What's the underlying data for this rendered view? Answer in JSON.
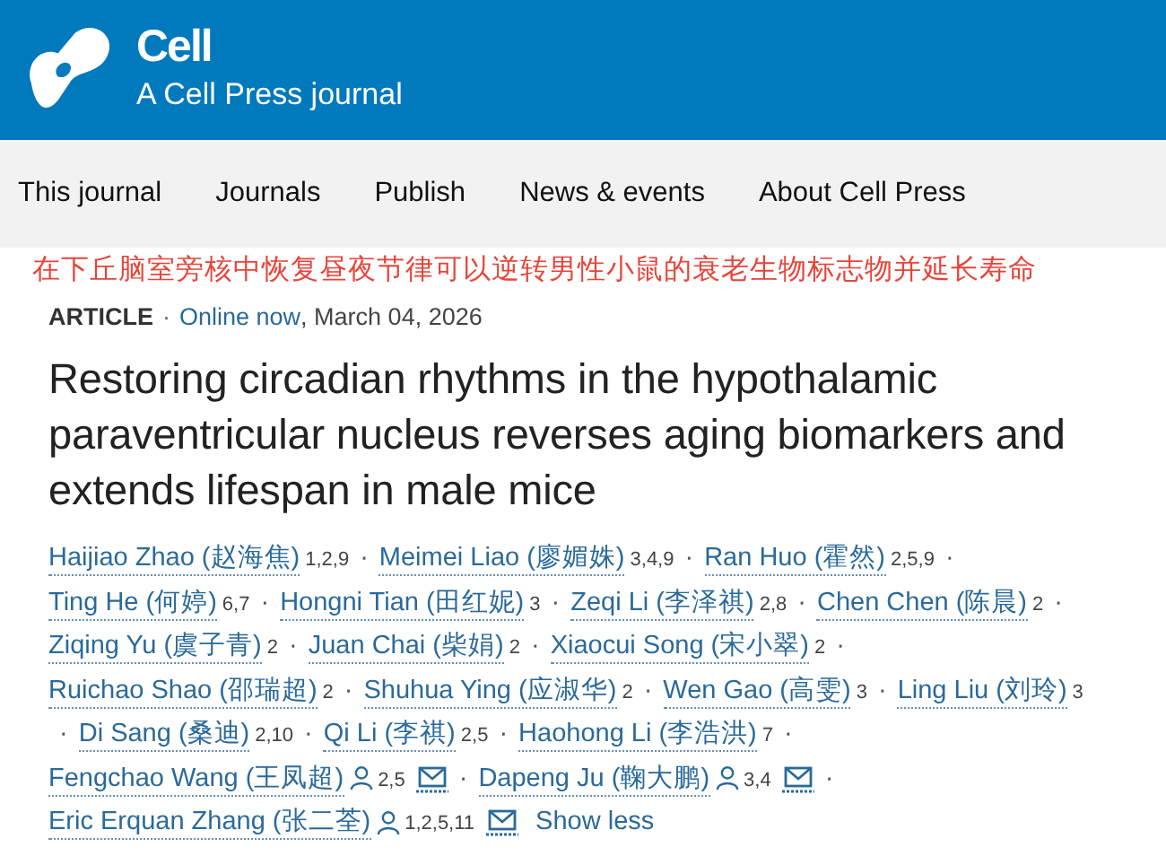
{
  "header": {
    "brand": "Cell",
    "tagline": "A Cell Press journal"
  },
  "nav": [
    {
      "label": "This journal"
    },
    {
      "label": "Journals"
    },
    {
      "label": "Publish"
    },
    {
      "label": "News & events"
    },
    {
      "label": "About Cell Press"
    }
  ],
  "translation": "在下丘脑室旁核中恢复昼夜节律可以逆转男性小鼠的衰老生物标志物并延长寿命",
  "meta": {
    "type": "ARTICLE",
    "dot": "·",
    "status": "Online now",
    "date": ", March 04, 2026"
  },
  "title": "Restoring circadian rhythms in the hypothalamic paraventricular nucleus reverses aging biomarkers and extends lifespan in male mice",
  "author_lines": [
    [
      {
        "kind": "author",
        "name": "Haijiao Zhao (赵海焦)",
        "affil": "1,2,9",
        "corresponding": false,
        "email": false
      },
      {
        "kind": "sep",
        "text": "·"
      },
      {
        "kind": "author",
        "name": "Meimei Liao (廖媚姝)",
        "affil": "3,4,9",
        "corresponding": false,
        "email": false
      },
      {
        "kind": "sep",
        "text": "·"
      },
      {
        "kind": "author",
        "name": "Ran Huo (霍然)",
        "affil": "2,5,9",
        "corresponding": false,
        "email": false
      },
      {
        "kind": "sep",
        "text": "·"
      }
    ],
    [
      {
        "kind": "author",
        "name": "Ting He (何婷)",
        "affil": "6,7",
        "corresponding": false,
        "email": false
      },
      {
        "kind": "sep",
        "text": "·"
      },
      {
        "kind": "author",
        "name": "Hongni Tian (田红妮)",
        "affil": "3",
        "corresponding": false,
        "email": false
      },
      {
        "kind": "sep",
        "text": "·"
      },
      {
        "kind": "author",
        "name": "Zeqi Li (李泽祺)",
        "affil": "2,8",
        "corresponding": false,
        "email": false
      },
      {
        "kind": "sep",
        "text": "·"
      },
      {
        "kind": "author",
        "name": "Chen Chen (陈晨)",
        "affil": "2",
        "corresponding": false,
        "email": false
      },
      {
        "kind": "sep",
        "text": "·"
      }
    ],
    [
      {
        "kind": "author",
        "name": "Ziqing Yu (虞子青)",
        "affil": "2",
        "corresponding": false,
        "email": false
      },
      {
        "kind": "sep",
        "text": "·"
      },
      {
        "kind": "author",
        "name": "Juan Chai (柴娟)",
        "affil": "2",
        "corresponding": false,
        "email": false
      },
      {
        "kind": "sep",
        "text": "·"
      },
      {
        "kind": "author",
        "name": "Xiaocui Song (宋小翠)",
        "affil": "2",
        "corresponding": false,
        "email": false
      },
      {
        "kind": "sep",
        "text": "·"
      }
    ],
    [
      {
        "kind": "author",
        "name": "Ruichao Shao (邵瑞超)",
        "affil": "2",
        "corresponding": false,
        "email": false
      },
      {
        "kind": "sep",
        "text": "·"
      },
      {
        "kind": "author",
        "name": "Shuhua Ying (应淑华)",
        "affil": "2",
        "corresponding": false,
        "email": false
      },
      {
        "kind": "sep",
        "text": "·"
      },
      {
        "kind": "author",
        "name": "Wen Gao (高雯)",
        "affil": "3",
        "corresponding": false,
        "email": false
      },
      {
        "kind": "sep",
        "text": "·"
      },
      {
        "kind": "author",
        "name": "Ling Liu (刘玲)",
        "affil": "3",
        "corresponding": false,
        "email": false
      }
    ],
    [
      {
        "kind": "sep",
        "text": "·"
      },
      {
        "kind": "author",
        "name": "Di Sang (桑迪)",
        "affil": "2,10",
        "corresponding": false,
        "email": false
      },
      {
        "kind": "sep",
        "text": "·"
      },
      {
        "kind": "author",
        "name": "Qi Li (李祺)",
        "affil": "2,5",
        "corresponding": false,
        "email": false
      },
      {
        "kind": "sep",
        "text": "·"
      },
      {
        "kind": "author",
        "name": "Haohong Li (李浩洪)",
        "affil": "7",
        "corresponding": false,
        "email": false
      },
      {
        "kind": "sep",
        "text": "·"
      }
    ],
    [
      {
        "kind": "author",
        "name": "Fengchao Wang (王凤超)",
        "affil": "2,5",
        "corresponding": true,
        "email": true
      },
      {
        "kind": "sep",
        "text": "·"
      },
      {
        "kind": "author",
        "name": "Dapeng Ju (鞠大鹏)",
        "affil": "3,4",
        "corresponding": true,
        "email": true
      },
      {
        "kind": "sep",
        "text": "·"
      }
    ],
    [
      {
        "kind": "author",
        "name": "Eric Erquan Zhang (张二荃)",
        "affil": "1,2,5,11",
        "corresponding": true,
        "email": true
      },
      {
        "kind": "link",
        "text": "Show less"
      }
    ]
  ]
}
